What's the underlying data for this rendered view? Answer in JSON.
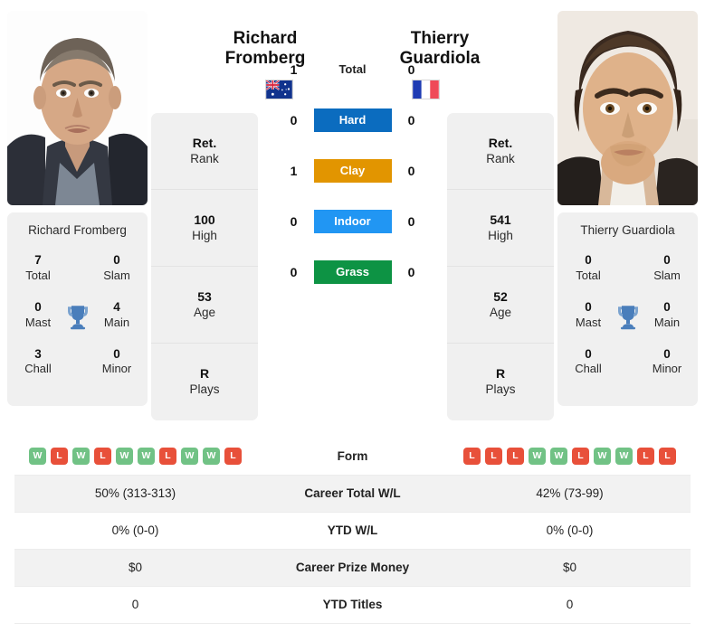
{
  "players": {
    "left": {
      "name_line1": "Richard",
      "name_line2": "Fromberg",
      "full_name": "Richard Fromberg",
      "country": "Australia",
      "flag_icon": "flag-australia-icon",
      "photo_alt": "richard-fromberg-photo",
      "info": [
        {
          "value": "Ret.",
          "label": "Rank"
        },
        {
          "value": "100",
          "label": "High"
        },
        {
          "value": "53",
          "label": "Age"
        },
        {
          "value": "R",
          "label": "Plays"
        }
      ],
      "titles": [
        {
          "value": "7",
          "label": "Total"
        },
        {
          "value": "0",
          "label": "Slam"
        },
        {
          "value": "0",
          "label": "Mast"
        },
        {
          "value": "4",
          "label": "Main"
        },
        {
          "value": "3",
          "label": "Chall"
        },
        {
          "value": "0",
          "label": "Minor"
        }
      ],
      "form": [
        "W",
        "L",
        "W",
        "L",
        "W",
        "W",
        "L",
        "W",
        "W",
        "L"
      ],
      "career_total_wl": "50% (313-313)",
      "ytd_wl": "0% (0-0)",
      "career_prize_money": "$0",
      "ytd_titles": "0"
    },
    "right": {
      "name_line1": "Thierry",
      "name_line2": "Guardiola",
      "full_name": "Thierry Guardiola",
      "country": "France",
      "flag_icon": "flag-france-icon",
      "photo_alt": "thierry-guardiola-photo",
      "info": [
        {
          "value": "Ret.",
          "label": "Rank"
        },
        {
          "value": "541",
          "label": "High"
        },
        {
          "value": "52",
          "label": "Age"
        },
        {
          "value": "R",
          "label": "Plays"
        }
      ],
      "titles": [
        {
          "value": "0",
          "label": "Total"
        },
        {
          "value": "0",
          "label": "Slam"
        },
        {
          "value": "0",
          "label": "Mast"
        },
        {
          "value": "0",
          "label": "Main"
        },
        {
          "value": "0",
          "label": "Chall"
        },
        {
          "value": "0",
          "label": "Minor"
        }
      ],
      "form": [
        "L",
        "L",
        "L",
        "W",
        "W",
        "L",
        "W",
        "W",
        "L",
        "L"
      ],
      "career_total_wl": "42% (73-99)",
      "ytd_wl": "0% (0-0)",
      "career_prize_money": "$0",
      "ytd_titles": "0"
    }
  },
  "head_to_head": [
    {
      "label": "Total",
      "left": "1",
      "right": "0",
      "color": ""
    },
    {
      "label": "Hard",
      "left": "0",
      "right": "0",
      "color": "#0b6cbf"
    },
    {
      "label": "Clay",
      "left": "1",
      "right": "0",
      "color": "#e29500"
    },
    {
      "label": "Indoor",
      "left": "0",
      "right": "0",
      "color": "#2196f3"
    },
    {
      "label": "Grass",
      "left": "0",
      "right": "0",
      "color": "#0d9344"
    }
  ],
  "table_rows": [
    {
      "label": "Form",
      "key": "form"
    },
    {
      "label": "Career Total W/L",
      "key": "career_total_wl"
    },
    {
      "label": "YTD W/L",
      "key": "ytd_wl"
    },
    {
      "label": "Career Prize Money",
      "key": "career_prize_money"
    },
    {
      "label": "YTD Titles",
      "key": "ytd_titles"
    }
  ],
  "colors": {
    "hard": "#0b6cbf",
    "clay": "#e29500",
    "indoor": "#2196f3",
    "grass": "#0d9344",
    "win_badge": "#71c285",
    "loss_badge": "#e8503a",
    "card_bg": "#f0f0f0",
    "trophy": "#4a7ebb"
  }
}
